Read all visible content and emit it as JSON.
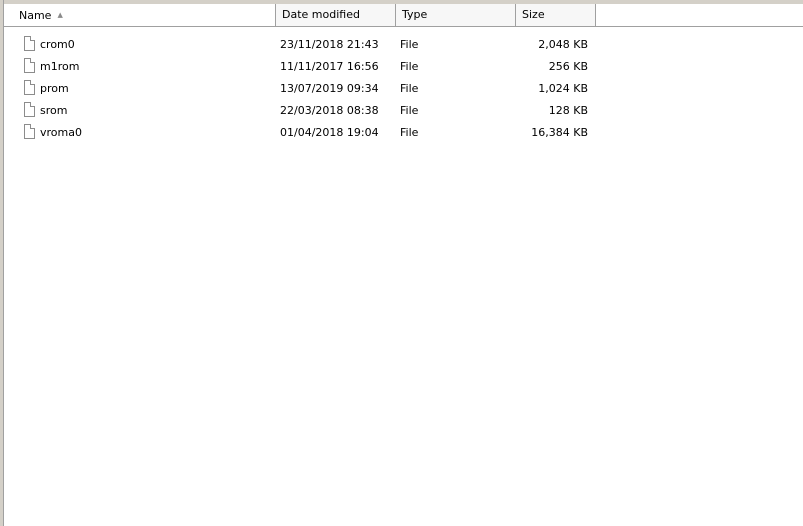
{
  "columns": {
    "name": "Name",
    "date": "Date modified",
    "type": "Type",
    "size": "Size"
  },
  "sort": {
    "column": "name",
    "icon": "sort-ascending-icon"
  },
  "files": [
    {
      "name": "crom0",
      "date": "23/11/2018 21:43",
      "type": "File",
      "size": "2,048 KB"
    },
    {
      "name": "m1rom",
      "date": "11/11/2017 16:56",
      "type": "File",
      "size": "256 KB"
    },
    {
      "name": "prom",
      "date": "13/07/2019 09:34",
      "type": "File",
      "size": "1,024 KB"
    },
    {
      "name": "srom",
      "date": "22/03/2018 08:38",
      "type": "File",
      "size": "128 KB"
    },
    {
      "name": "vroma0",
      "date": "01/04/2018 19:04",
      "type": "File",
      "size": "16,384 KB"
    }
  ]
}
